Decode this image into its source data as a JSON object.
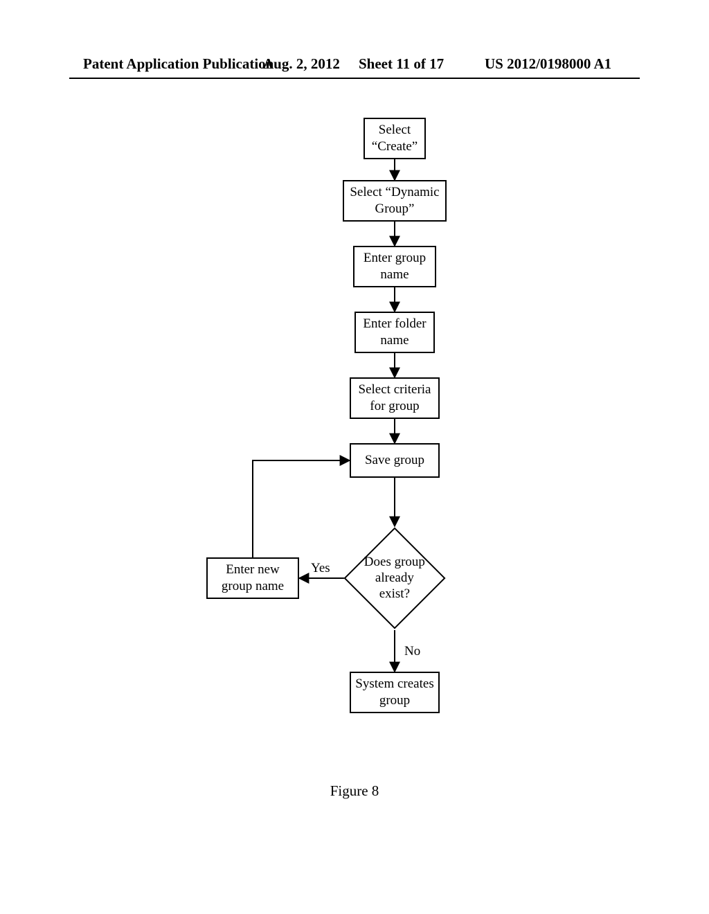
{
  "header": {
    "left": "Patent Application Publication",
    "date": "Aug. 2, 2012",
    "sheet": "Sheet 11 of 17",
    "pubno": "US 2012/0198000 A1"
  },
  "flow": {
    "b1": "Select “Create”",
    "b2": "Select “Dynamic Group”",
    "b3": "Enter group name",
    "b4": "Enter folder name",
    "b5": "Select criteria for group",
    "b6": "Save group",
    "d1": "Does group already exist?",
    "b7": "Enter new group name",
    "b8": "System creates group",
    "yes": "Yes",
    "no": "No"
  },
  "caption": "Figure 8",
  "chart_data": {
    "type": "flowchart",
    "title": "Figure 8",
    "nodes": [
      {
        "id": "b1",
        "type": "process",
        "label": "Select \"Create\""
      },
      {
        "id": "b2",
        "type": "process",
        "label": "Select \"Dynamic Group\""
      },
      {
        "id": "b3",
        "type": "process",
        "label": "Enter group name"
      },
      {
        "id": "b4",
        "type": "process",
        "label": "Enter folder name"
      },
      {
        "id": "b5",
        "type": "process",
        "label": "Select criteria for group"
      },
      {
        "id": "b6",
        "type": "process",
        "label": "Save group"
      },
      {
        "id": "d1",
        "type": "decision",
        "label": "Does group already exist?"
      },
      {
        "id": "b7",
        "type": "process",
        "label": "Enter new group name"
      },
      {
        "id": "b8",
        "type": "process",
        "label": "System creates group"
      }
    ],
    "edges": [
      {
        "from": "b1",
        "to": "b2"
      },
      {
        "from": "b2",
        "to": "b3"
      },
      {
        "from": "b3",
        "to": "b4"
      },
      {
        "from": "b4",
        "to": "b5"
      },
      {
        "from": "b5",
        "to": "b6"
      },
      {
        "from": "b6",
        "to": "d1"
      },
      {
        "from": "d1",
        "to": "b7",
        "label": "Yes"
      },
      {
        "from": "d1",
        "to": "b8",
        "label": "No"
      },
      {
        "from": "b7",
        "to": "b6"
      }
    ]
  }
}
